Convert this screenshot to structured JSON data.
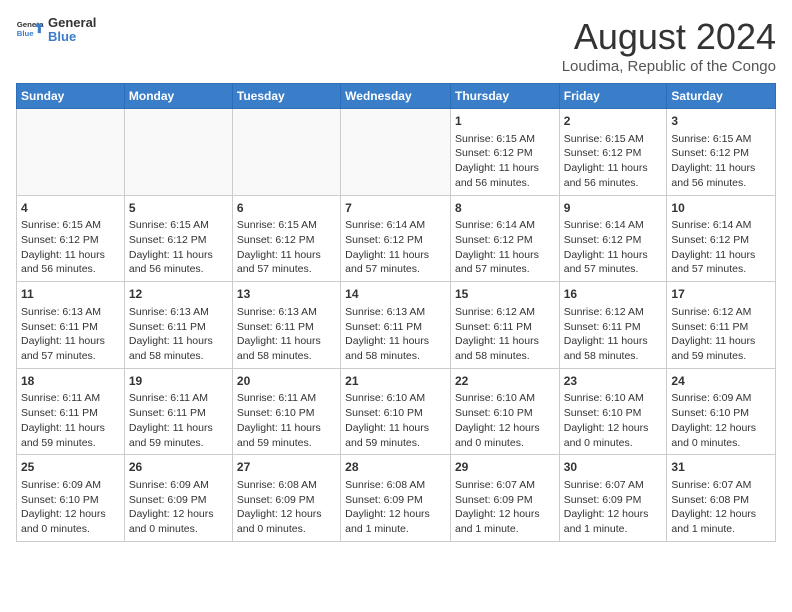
{
  "header": {
    "logo_line1": "General",
    "logo_line2": "Blue",
    "month_title": "August 2024",
    "subtitle": "Loudima, Republic of the Congo"
  },
  "weekdays": [
    "Sunday",
    "Monday",
    "Tuesday",
    "Wednesday",
    "Thursday",
    "Friday",
    "Saturday"
  ],
  "weeks": [
    [
      {
        "day": "",
        "content": ""
      },
      {
        "day": "",
        "content": ""
      },
      {
        "day": "",
        "content": ""
      },
      {
        "day": "",
        "content": ""
      },
      {
        "day": "1",
        "content": "Sunrise: 6:15 AM\nSunset: 6:12 PM\nDaylight: 11 hours and 56 minutes."
      },
      {
        "day": "2",
        "content": "Sunrise: 6:15 AM\nSunset: 6:12 PM\nDaylight: 11 hours and 56 minutes."
      },
      {
        "day": "3",
        "content": "Sunrise: 6:15 AM\nSunset: 6:12 PM\nDaylight: 11 hours and 56 minutes."
      }
    ],
    [
      {
        "day": "4",
        "content": "Sunrise: 6:15 AM\nSunset: 6:12 PM\nDaylight: 11 hours and 56 minutes."
      },
      {
        "day": "5",
        "content": "Sunrise: 6:15 AM\nSunset: 6:12 PM\nDaylight: 11 hours and 56 minutes."
      },
      {
        "day": "6",
        "content": "Sunrise: 6:15 AM\nSunset: 6:12 PM\nDaylight: 11 hours and 57 minutes."
      },
      {
        "day": "7",
        "content": "Sunrise: 6:14 AM\nSunset: 6:12 PM\nDaylight: 11 hours and 57 minutes."
      },
      {
        "day": "8",
        "content": "Sunrise: 6:14 AM\nSunset: 6:12 PM\nDaylight: 11 hours and 57 minutes."
      },
      {
        "day": "9",
        "content": "Sunrise: 6:14 AM\nSunset: 6:12 PM\nDaylight: 11 hours and 57 minutes."
      },
      {
        "day": "10",
        "content": "Sunrise: 6:14 AM\nSunset: 6:12 PM\nDaylight: 11 hours and 57 minutes."
      }
    ],
    [
      {
        "day": "11",
        "content": "Sunrise: 6:13 AM\nSunset: 6:11 PM\nDaylight: 11 hours and 57 minutes."
      },
      {
        "day": "12",
        "content": "Sunrise: 6:13 AM\nSunset: 6:11 PM\nDaylight: 11 hours and 58 minutes."
      },
      {
        "day": "13",
        "content": "Sunrise: 6:13 AM\nSunset: 6:11 PM\nDaylight: 11 hours and 58 minutes."
      },
      {
        "day": "14",
        "content": "Sunrise: 6:13 AM\nSunset: 6:11 PM\nDaylight: 11 hours and 58 minutes."
      },
      {
        "day": "15",
        "content": "Sunrise: 6:12 AM\nSunset: 6:11 PM\nDaylight: 11 hours and 58 minutes."
      },
      {
        "day": "16",
        "content": "Sunrise: 6:12 AM\nSunset: 6:11 PM\nDaylight: 11 hours and 58 minutes."
      },
      {
        "day": "17",
        "content": "Sunrise: 6:12 AM\nSunset: 6:11 PM\nDaylight: 11 hours and 59 minutes."
      }
    ],
    [
      {
        "day": "18",
        "content": "Sunrise: 6:11 AM\nSunset: 6:11 PM\nDaylight: 11 hours and 59 minutes."
      },
      {
        "day": "19",
        "content": "Sunrise: 6:11 AM\nSunset: 6:11 PM\nDaylight: 11 hours and 59 minutes."
      },
      {
        "day": "20",
        "content": "Sunrise: 6:11 AM\nSunset: 6:10 PM\nDaylight: 11 hours and 59 minutes."
      },
      {
        "day": "21",
        "content": "Sunrise: 6:10 AM\nSunset: 6:10 PM\nDaylight: 11 hours and 59 minutes."
      },
      {
        "day": "22",
        "content": "Sunrise: 6:10 AM\nSunset: 6:10 PM\nDaylight: 12 hours and 0 minutes."
      },
      {
        "day": "23",
        "content": "Sunrise: 6:10 AM\nSunset: 6:10 PM\nDaylight: 12 hours and 0 minutes."
      },
      {
        "day": "24",
        "content": "Sunrise: 6:09 AM\nSunset: 6:10 PM\nDaylight: 12 hours and 0 minutes."
      }
    ],
    [
      {
        "day": "25",
        "content": "Sunrise: 6:09 AM\nSunset: 6:10 PM\nDaylight: 12 hours and 0 minutes."
      },
      {
        "day": "26",
        "content": "Sunrise: 6:09 AM\nSunset: 6:09 PM\nDaylight: 12 hours and 0 minutes."
      },
      {
        "day": "27",
        "content": "Sunrise: 6:08 AM\nSunset: 6:09 PM\nDaylight: 12 hours and 0 minutes."
      },
      {
        "day": "28",
        "content": "Sunrise: 6:08 AM\nSunset: 6:09 PM\nDaylight: 12 hours and 1 minute."
      },
      {
        "day": "29",
        "content": "Sunrise: 6:07 AM\nSunset: 6:09 PM\nDaylight: 12 hours and 1 minute."
      },
      {
        "day": "30",
        "content": "Sunrise: 6:07 AM\nSunset: 6:09 PM\nDaylight: 12 hours and 1 minute."
      },
      {
        "day": "31",
        "content": "Sunrise: 6:07 AM\nSunset: 6:08 PM\nDaylight: 12 hours and 1 minute."
      }
    ]
  ]
}
